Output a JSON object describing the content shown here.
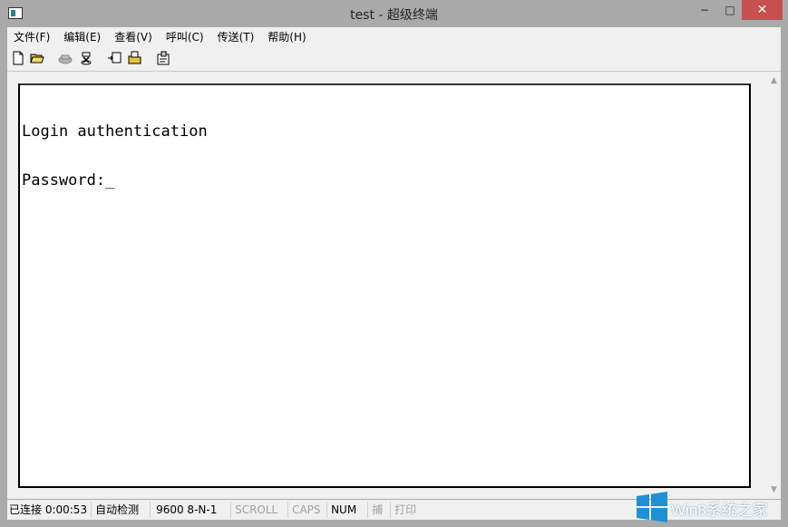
{
  "window": {
    "title": "test - 超级终端",
    "controls": {
      "minimize": "−",
      "maximize": "□",
      "close": "✕"
    }
  },
  "menu": {
    "items": [
      "文件(F)",
      "编辑(E)",
      "查看(V)",
      "呼叫(C)",
      "传送(T)",
      "帮助(H)"
    ]
  },
  "toolbar": {
    "buttons": [
      "new-file-icon",
      "open-folder-icon",
      "call-icon",
      "disconnect-icon",
      "send-file-icon",
      "receive-file-icon",
      "properties-icon"
    ]
  },
  "terminal": {
    "lines": [
      "Login authentication",
      "Password:_"
    ]
  },
  "status": {
    "connection": "已连接 0:00:53",
    "detect": "自动检测",
    "port_settings": "9600 8-N-1",
    "scroll": "SCROLL",
    "caps": "CAPS",
    "num": "NUM",
    "capture": "捕",
    "print": "打印"
  },
  "watermark": {
    "text": "Win8系统之家"
  },
  "colors": {
    "frame": "#aaaaaa",
    "close_button": "#c7504e",
    "chrome": "#f0f0f0",
    "terminal_bg": "#ffffff",
    "watermark_blue": "#1e90d6"
  }
}
